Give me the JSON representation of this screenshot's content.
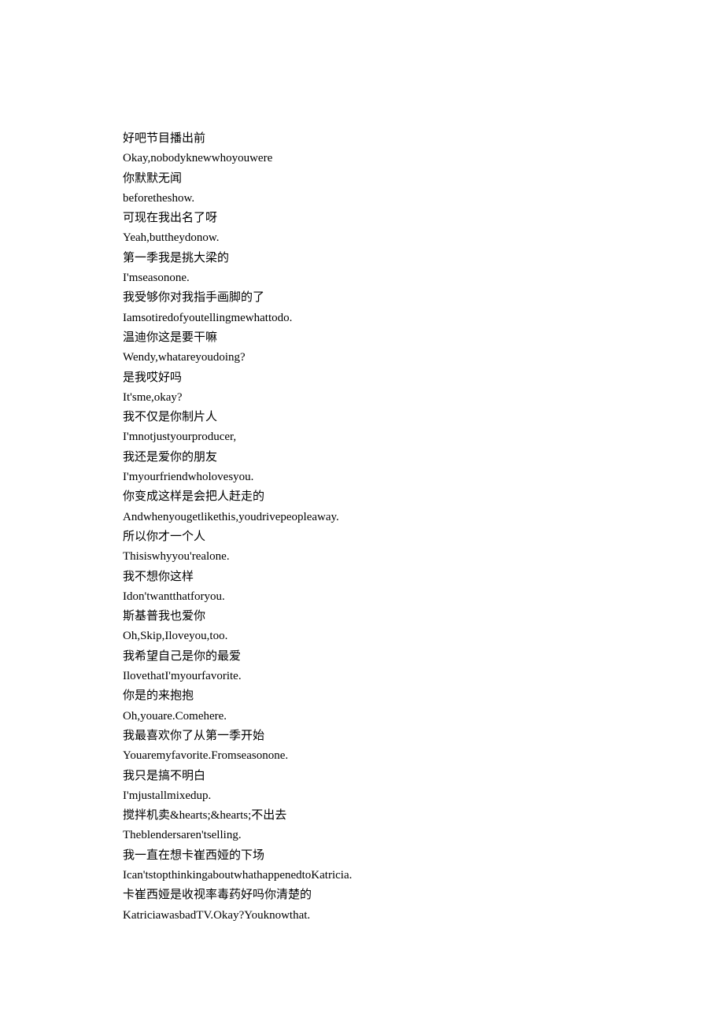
{
  "lines": [
    "好吧节目播出前",
    "Okay,nobodyknewwhoyouwere",
    "你默默无闻",
    "beforetheshow.",
    "可现在我出名了呀",
    "Yeah,buttheydonow.",
    "第一季我是挑大梁的",
    "I'mseasonone.",
    "我受够你对我指手画脚的了",
    "Iamsotiredofyoutellingmewhattodo.",
    "温迪你这是要干嘛",
    "Wendy,whatareyoudoing?",
    "是我哎好吗",
    "It'sme,okay?",
    "我不仅是你制片人",
    "I'mnotjustyourproducer,",
    "我还是爱你的朋友",
    "I'myourfriendwholovesyou.",
    "你变成这样是会把人赶走的",
    "Andwhenyougetlikethis,youdrivepeopleaway.",
    "所以你才一个人",
    "Thisiswhyyou'realone.",
    "我不想你这样",
    "Idon'twantthatforyou.",
    "斯基普我也爱你",
    "Oh,Skip,Iloveyou,too.",
    "我希望自己是你的最爱",
    "IlovethatI'myourfavorite.",
    "你是的来抱抱",
    "Oh,youare.Comehere.",
    "我最喜欢你了从第一季开始",
    "Youaremyfavorite.Fromseasonone.",
    "我只是搞不明白",
    "I'mjustallmixedup.",
    "搅拌机卖&hearts;&hearts;不出去",
    "Theblendersaren'tselling.",
    "我一直在想卡崔西娅的下场",
    "Ican'tstopthinkingaboutwhathappenedtoKatricia.",
    "卡崔西娅是收视率毒药好吗你清楚的",
    "KatriciawasbadTV.Okay?Youknowthat."
  ]
}
